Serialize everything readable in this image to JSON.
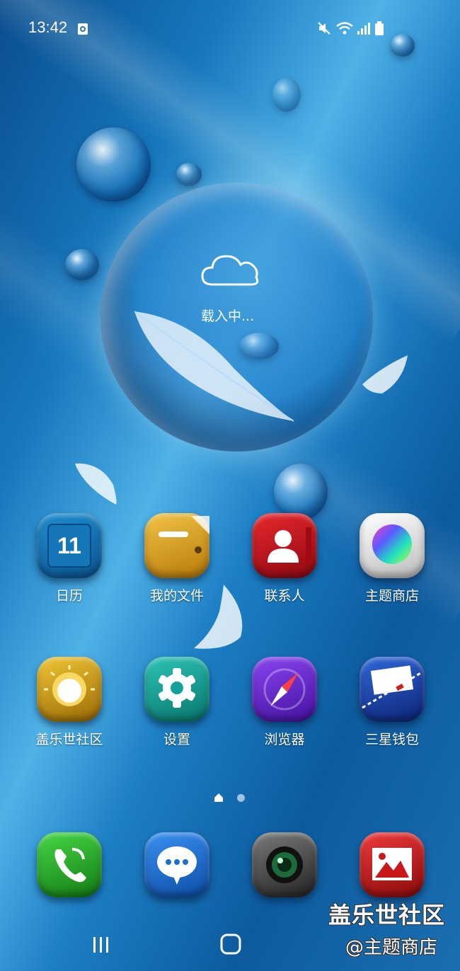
{
  "status_bar": {
    "time": "13:42",
    "icons": [
      "notification-icon",
      "mute-icon",
      "wifi-icon",
      "signal-icon",
      "battery-icon"
    ]
  },
  "weather_widget": {
    "icon": "cloud-icon",
    "status": "载入中..."
  },
  "apps_row1": [
    {
      "label": "日历",
      "icon": "calendar-icon",
      "badge": "11",
      "color": "#0d6aa8"
    },
    {
      "label": "我的文件",
      "icon": "folder-icon",
      "color": "#d79a10"
    },
    {
      "label": "联系人",
      "icon": "contacts-icon",
      "color": "#c4101a"
    },
    {
      "label": "主题商店",
      "icon": "theme-store-icon",
      "color": "#e6e6e6"
    }
  ],
  "apps_row2": [
    {
      "label": "盖乐世社区",
      "icon": "community-icon",
      "color": "#d2a015"
    },
    {
      "label": "设置",
      "icon": "settings-icon",
      "color": "#13a29a"
    },
    {
      "label": "浏览器",
      "icon": "browser-icon",
      "color": "#6b2ad1"
    },
    {
      "label": "三星钱包",
      "icon": "wallet-icon",
      "color": "#1a3fa8"
    }
  ],
  "page_indicator": {
    "pages": 2,
    "current": 1
  },
  "dock": [
    {
      "icon": "phone-icon",
      "color": "#2bb52b"
    },
    {
      "icon": "messages-icon",
      "color": "#1a6fd0"
    },
    {
      "icon": "camera-icon",
      "color": "#505050"
    },
    {
      "icon": "gallery-icon",
      "color": "#c81818"
    }
  ],
  "watermark": {
    "line1": "盖乐世社区",
    "line2": "@主题商店"
  },
  "navigation": [
    "recent-apps-button",
    "home-button",
    "back-button"
  ]
}
